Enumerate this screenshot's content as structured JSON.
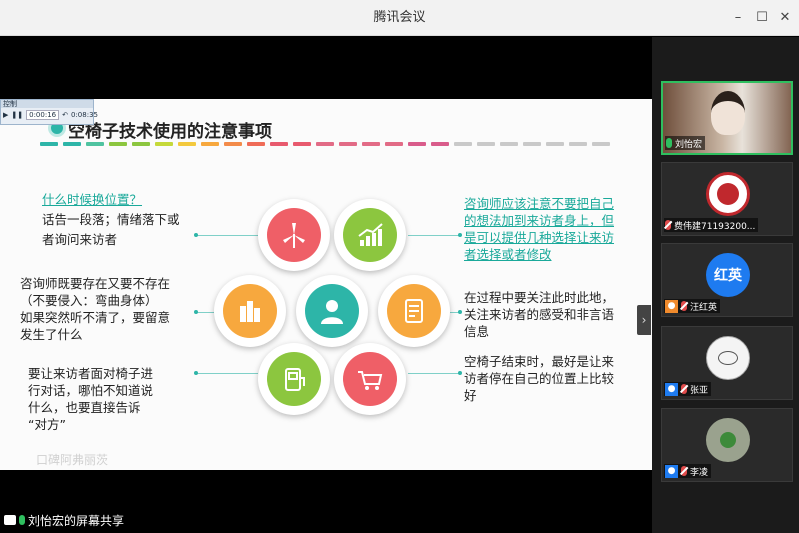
{
  "window": {
    "title": "腾讯会议"
  },
  "player": {
    "label": "控制",
    "elapsed": "0:00:16",
    "total": "0:08:35"
  },
  "slide": {
    "title": "空椅子技术使用的注意事项",
    "dash_colors": [
      "#2db5a8",
      "#2db5a8",
      "#4fc3a0",
      "#8cc63f",
      "#8cc63f",
      "#c5d93a",
      "#f3c93d",
      "#f7a83e",
      "#f38b4a",
      "#ef6b57",
      "#e85a6e",
      "#e85a6e",
      "#e26b86",
      "#e26b86",
      "#e26b86",
      "#e26b86",
      "#d95c8b",
      "#d95c8b",
      "#c9c9c9",
      "#c9c9c9",
      "#c9c9c9",
      "#c9c9c9",
      "#c9c9c9",
      "#c9c9c9",
      "#c9c9c9"
    ],
    "left": {
      "q1_heading": "什么时候换位置？",
      "q1_line1": "话告一段落；情绪落下或",
      "q1_line2": "者询问来访者",
      "q2_line1": "咨询师既要存在又要不存在",
      "q2_line2": "（不要侵入：弯曲身体）",
      "q2_line3": "如果突然听不清了，要留意",
      "q2_line4": "发生了什么",
      "q3_line1": "要让来访者面对椅子进",
      "q3_line2": "行对话，哪怕不知道说",
      "q3_line3": "什么，也要直接告诉",
      "q3_line4": "“对方”"
    },
    "right": {
      "r1_line1": "咨询师应该注意不要把自己",
      "r1_line2": "的想法加到来访者身上，但",
      "r1_line3": "是可以提供几种选择让来访",
      "r1_line4": "者选择或者修改",
      "r2_line1": "在过程中要关注此时此地，",
      "r2_line2": "关注来访者的感受和非言语",
      "r2_line3": "信息",
      "r3_line1": "空椅子结束时，最好是让来",
      "r3_line2": "访者停在自己的位置上比较",
      "r3_line3": "好"
    },
    "circle_colors": {
      "windmill": "#ef5f67",
      "growth": "#8cc63f",
      "building": "#f7a83e",
      "person": "#2db5a8",
      "document": "#f7a83e",
      "meter": "#8cc63f",
      "cart": "#ef5f67"
    },
    "watermark": "口碑阿弗丽茨"
  },
  "share": {
    "caption": "刘怡宏的屏幕共享"
  },
  "participants": [
    {
      "name": "刘怡宏"
    },
    {
      "name": "费伟建71193200..."
    },
    {
      "name": "汪红英",
      "avatar_text": "红英",
      "avatar_color": "#1e7bf0"
    },
    {
      "name": "张亚"
    },
    {
      "name": "李凌"
    }
  ]
}
